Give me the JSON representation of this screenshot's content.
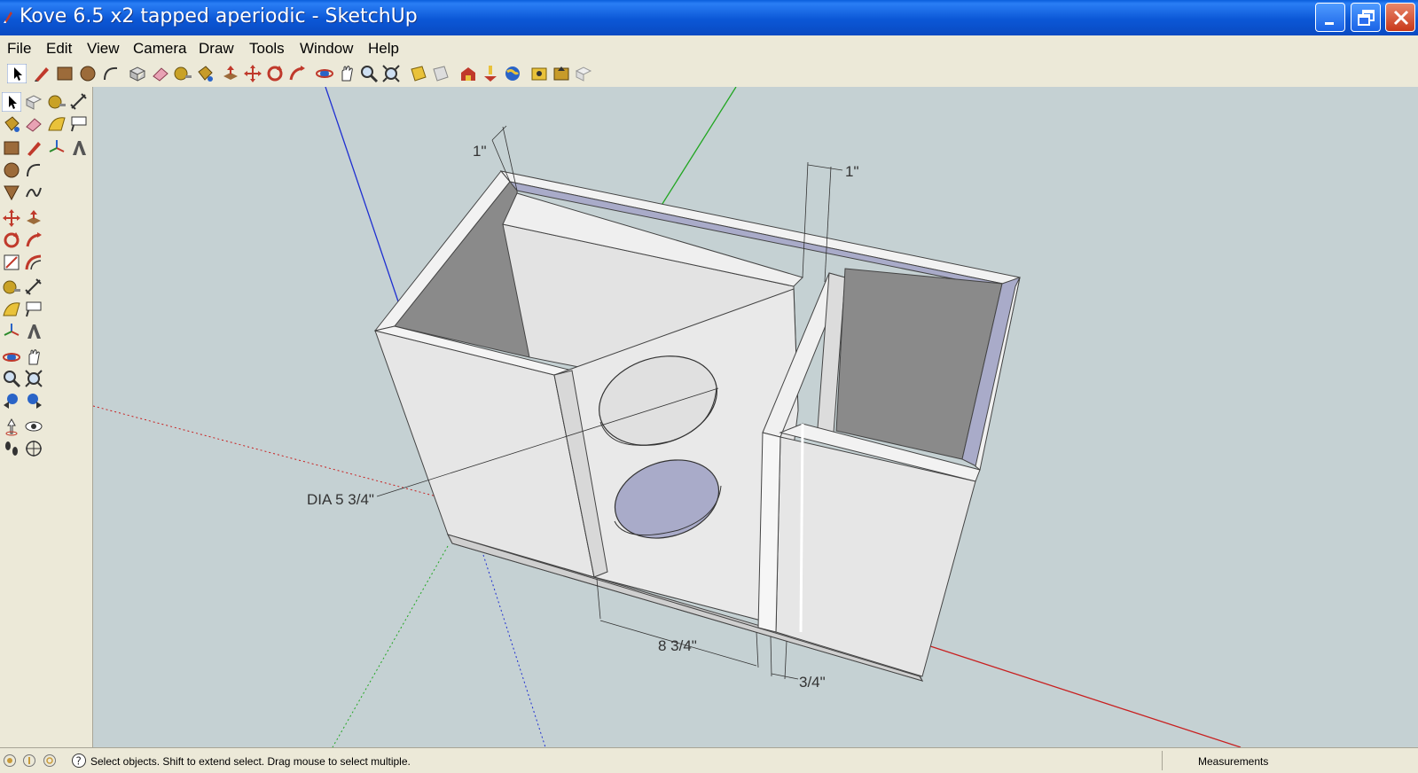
{
  "window": {
    "title": "Kove 6.5 x2 tapped aperiodic - SketchUp"
  },
  "menu": [
    "File",
    "Edit",
    "View",
    "Camera",
    "Draw",
    "Tools",
    "Window",
    "Help"
  ],
  "model": {
    "dims": {
      "wall_top_left": "1\"",
      "wall_top_right": "1\"",
      "driver_dia": "DIA 5 3/4\"",
      "chamber_width": "8 3/4\"",
      "panel_thickness": "3/4\""
    }
  },
  "status": {
    "hint": "Select objects. Shift to extend select. Drag mouse to select multiple.",
    "measurements_label": "Measurements"
  },
  "icons": {
    "top": [
      "select-icon",
      "pencil-icon",
      "rectangle-icon",
      "circle-icon",
      "arc-icon",
      "make-component-icon",
      "eraser-icon",
      "tape-measure-icon",
      "paint-bucket-icon",
      "push-pull-icon",
      "move-icon",
      "rotate-icon",
      "follow-me-icon",
      "orbit-icon",
      "pan-icon",
      "zoom-icon",
      "zoom-extents-icon",
      "section-plane-icon",
      "display-section-icon",
      "warehouse-icon",
      "place-model-icon",
      "preview-earth-icon",
      "component-icon",
      "share-model-icon",
      "extension-icon"
    ],
    "left": [
      "select-icon",
      "make-component-icon",
      "tape-measure-icon",
      "dimension-icon",
      "paint-bucket-icon",
      "eraser-icon",
      "protractor-icon",
      "text-icon",
      "rectangle-icon",
      "line-icon",
      "axes-icon",
      "3d-text-icon",
      "circle-icon",
      "arc-icon",
      "polygon-icon",
      "freehand-icon",
      "move-icon",
      "push-pull-icon",
      "rotate-icon",
      "follow-me-icon",
      "scale-icon",
      "offset-icon",
      "tape-measure-icon",
      "dimension-icon",
      "protractor-icon",
      "text-icon",
      "axes-icon",
      "3d-text-icon",
      "orbit-icon",
      "pan-icon",
      "zoom-icon",
      "zoom-window-icon",
      "previous-view-icon",
      "next-view-icon",
      "position-camera-icon",
      "look-around-icon",
      "walk-icon",
      "section-plane-icon"
    ]
  },
  "colors": {
    "titlebar": "#0b57d6",
    "viewport_bg": "#c5d1d3",
    "panel_face": "#e8e8e8",
    "panel_dark": "#8a8a8a",
    "interior_blue": "#a9abc9"
  }
}
